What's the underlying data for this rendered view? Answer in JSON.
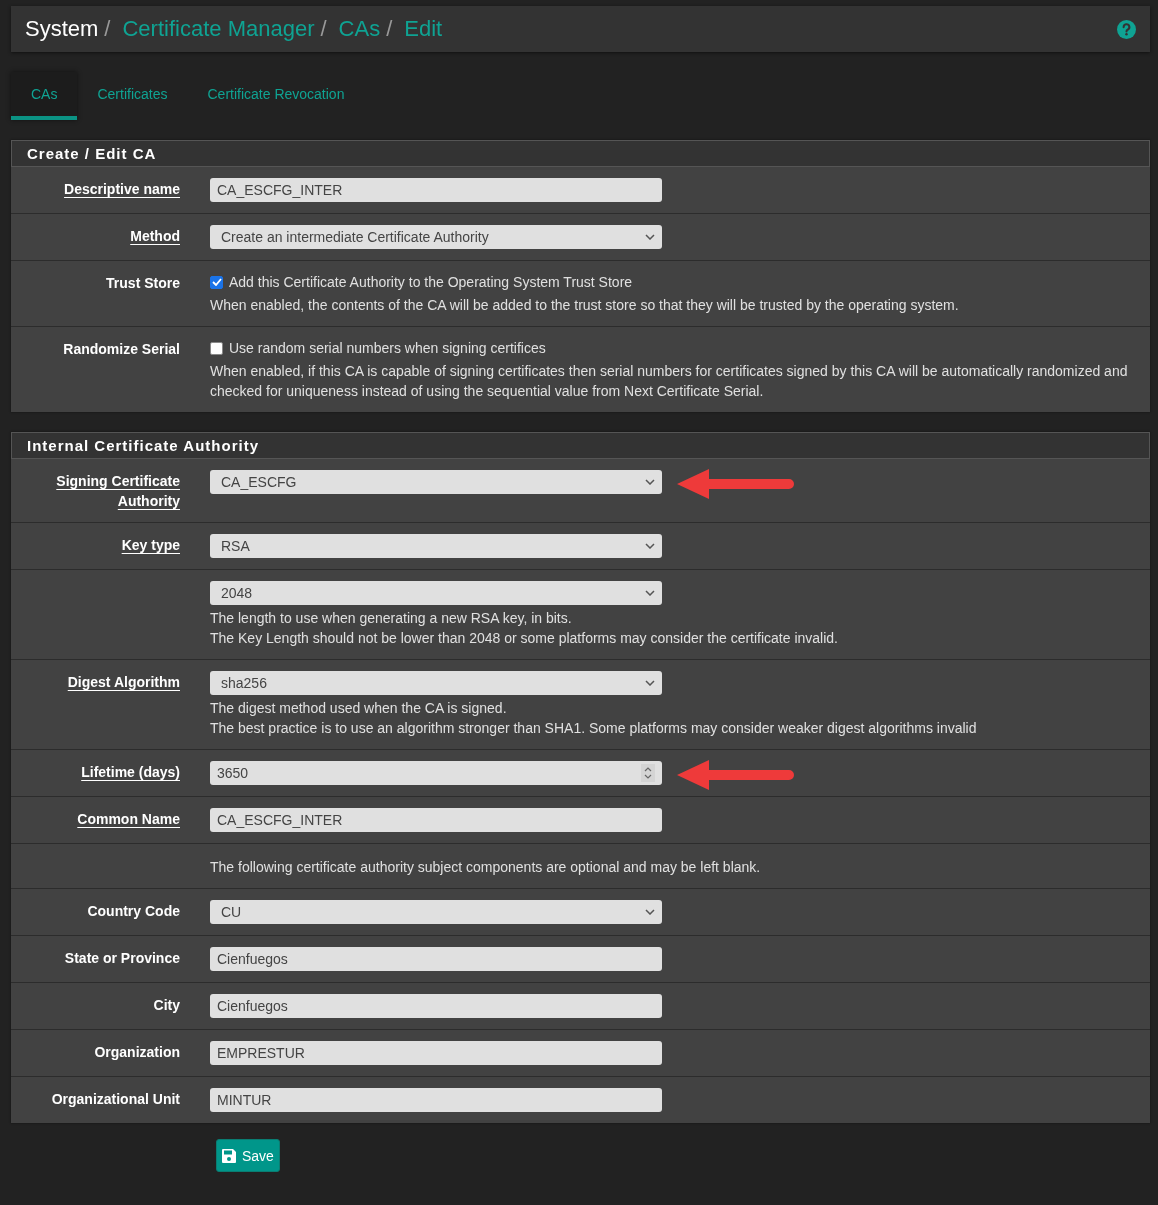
{
  "breadcrumb": [
    {
      "label": "System",
      "link": false
    },
    {
      "label": "Certificate Manager",
      "link": true
    },
    {
      "label": "CAs",
      "link": true
    },
    {
      "label": "Edit",
      "link": true
    }
  ],
  "breadcrumb_separator": "/",
  "tabs": [
    {
      "label": "CAs",
      "selected": true
    },
    {
      "label": "Certificates",
      "selected": false
    },
    {
      "label": "Certificate Revocation",
      "selected": false
    }
  ],
  "sections": [
    {
      "title": "Create / Edit CA",
      "rows": [
        {
          "kind": "text",
          "label": "Descriptive name",
          "required": true,
          "value": "CA_ESCFG_INTER"
        },
        {
          "kind": "select",
          "label": "Method",
          "required": true,
          "value": "Create an intermediate Certificate Authority"
        },
        {
          "kind": "checkbox",
          "label": "Trust Store",
          "required": false,
          "checked": true,
          "option": "Add this Certificate Authority to the Operating System Trust Store",
          "help": [
            "When enabled, the contents of the CA will be added to the trust store so that they will be trusted by the operating system."
          ]
        },
        {
          "kind": "checkbox",
          "label": "Randomize Serial",
          "required": false,
          "checked": false,
          "option": "Use random serial numbers when signing certifices",
          "help": [
            "When enabled, if this CA is capable of signing certificates then serial numbers for certificates signed by this CA will be automatically randomized and checked for uniqueness instead of using the sequential value from Next Certificate Serial."
          ]
        }
      ]
    },
    {
      "title": "Internal Certificate Authority",
      "rows": [
        {
          "kind": "select",
          "label": "Signing Certificate Authority",
          "required": true,
          "value": "CA_ESCFG",
          "arrow": true
        },
        {
          "kind": "select",
          "label": "Key type",
          "required": true,
          "value": "RSA"
        },
        {
          "kind": "select",
          "value": "2048",
          "help": [
            "The length to use when generating a new RSA key, in bits.",
            "The Key Length should not be lower than 2048 or some platforms may consider the certificate invalid."
          ]
        },
        {
          "kind": "select",
          "label": "Digest Algorithm",
          "required": true,
          "value": "sha256",
          "help": [
            "The digest method used when the CA is signed.",
            "The best practice is to use an algorithm stronger than SHA1. Some platforms may consider weaker digest algorithms invalid"
          ]
        },
        {
          "kind": "number",
          "label": "Lifetime (days)",
          "required": true,
          "value": "3650",
          "arrow": true
        },
        {
          "kind": "text",
          "label": "Common Name",
          "required": true,
          "value": "CA_ESCFG_INTER"
        },
        {
          "kind": "note",
          "text": "The following certificate authority subject components are optional and may be left blank."
        },
        {
          "kind": "select",
          "label": "Country Code",
          "required": false,
          "value": "CU"
        },
        {
          "kind": "text",
          "label": "State or Province",
          "required": false,
          "value": "Cienfuegos"
        },
        {
          "kind": "text",
          "label": "City",
          "required": false,
          "value": "Cienfuegos"
        },
        {
          "kind": "text",
          "label": "Organization",
          "required": false,
          "value": "EMPRESTUR"
        },
        {
          "kind": "text",
          "label": "Organizational Unit",
          "required": false,
          "value": "MINTUR"
        }
      ]
    }
  ],
  "save_button": "Save"
}
